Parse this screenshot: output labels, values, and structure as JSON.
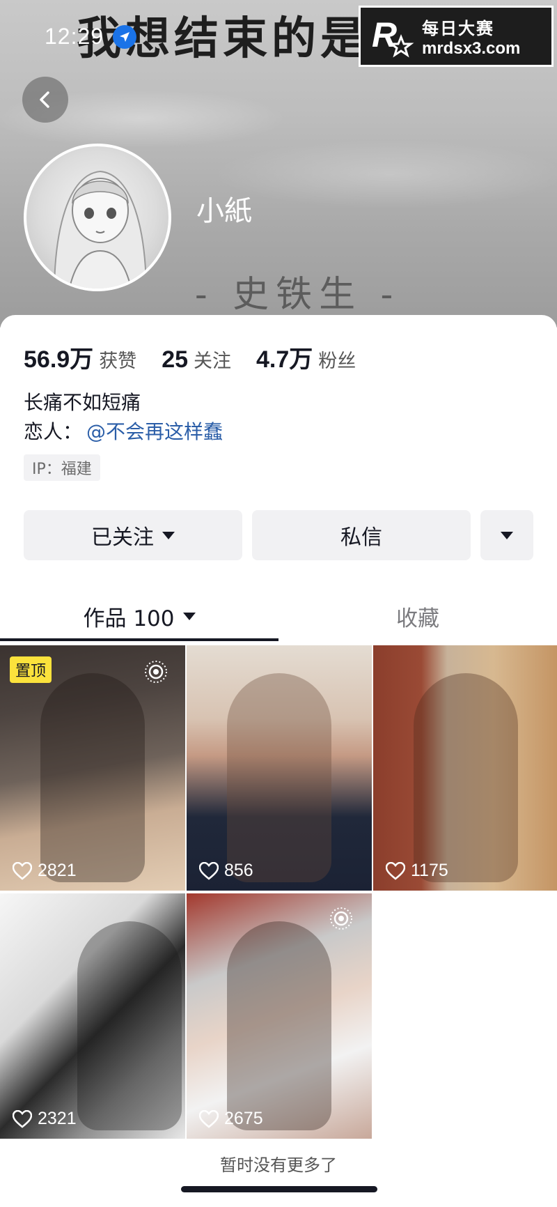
{
  "status_bar": {
    "time": "12:29"
  },
  "watermark": {
    "line1": "每日大赛",
    "line2": "mrdsx3.com",
    "logo_letter": "R"
  },
  "cover": {
    "big_text": "我想结束的是",
    "sub_text": "- 史铁生 -"
  },
  "profile": {
    "nickname": "小紙",
    "stats": [
      {
        "num": "56.9万",
        "label": "获赞"
      },
      {
        "num": "25",
        "label": "关注"
      },
      {
        "num": "4.7万",
        "label": "粉丝"
      }
    ],
    "bio": "长痛不如短痛",
    "lover_label": "恋人：",
    "lover_link": "@不会再这样蠢",
    "ip": "IP：福建"
  },
  "actions": {
    "follow": "已关注",
    "message": "私信"
  },
  "tabs": {
    "works": "作品 100",
    "favorites": "收藏"
  },
  "videos": [
    {
      "likes": "2821",
      "pinned_label": "置顶"
    },
    {
      "likes": "856"
    },
    {
      "likes": "1175"
    },
    {
      "likes": "2321"
    },
    {
      "likes": "2675"
    }
  ],
  "footer": {
    "no_more": "暂时没有更多了"
  },
  "colors": {
    "link": "#2b5ea8",
    "pin_badge": "#fbe23c",
    "location": "#1a73e8"
  }
}
